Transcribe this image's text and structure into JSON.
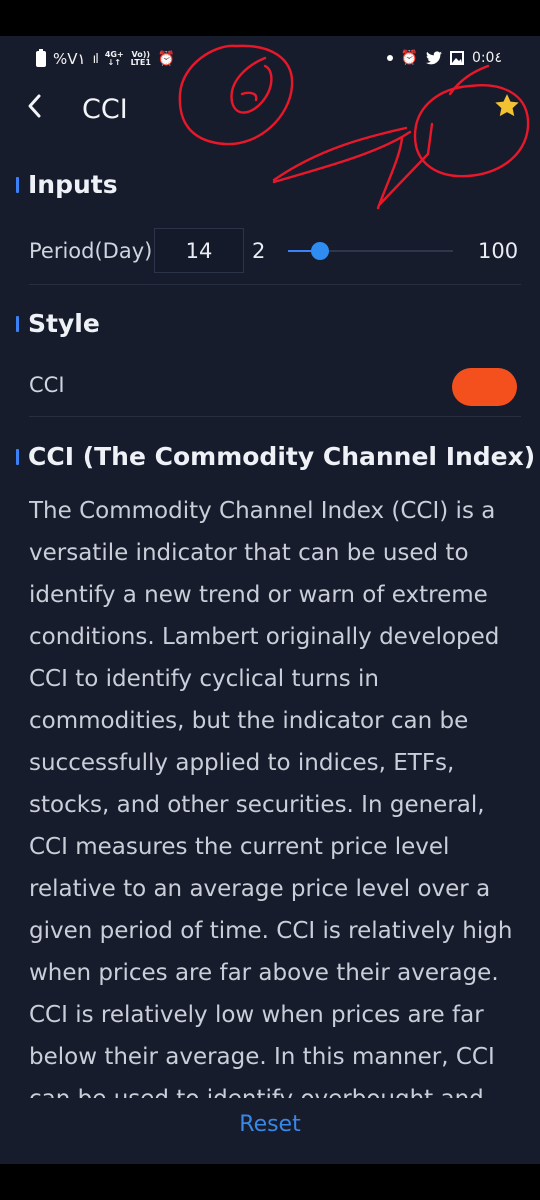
{
  "status_bar": {
    "left_text": "%V١",
    "signal_glyph": "ıl",
    "network_top": "4G+",
    "network_bottom": "LTE1",
    "volte_top": "Vo))",
    "time": "0:0٤",
    "icons": [
      "battery-icon",
      "signal-icon",
      "alarm-icon",
      "dot-icon",
      "alarm-icon",
      "twitter-icon",
      "gallery-icon"
    ]
  },
  "header": {
    "title": "CCI",
    "star_color": "#f2c233"
  },
  "inputs": {
    "heading": "Inputs",
    "period_label": "Period(Day)",
    "period_value": "14",
    "slider_min": "2",
    "slider_max": "100",
    "slider_value": 14
  },
  "style": {
    "heading": "Style",
    "cci_label": "CCI",
    "cci_color": "#f4501e"
  },
  "description": {
    "heading": "CCI (The Commodity Channel Index)",
    "body": "The Commodity Channel Index (CCI) is a versatile indicator that can be used to identify a new trend or warn of extreme conditions. Lambert originally developed CCI to identify cyclical turns in commodities, but the indicator can be successfully applied to indices, ETFs, stocks, and other securities. In general, CCI measures the current price level relative to an average price level over a given period of time. CCI is relatively high when prices are far above their average. CCI is relatively low when prices are far below their average. In this manner, CCI can be used to identify overbought and"
  },
  "footer": {
    "reset_label": "Reset"
  },
  "colors": {
    "background": "#161c2c",
    "accent": "#3b82f6",
    "annotation": "#e8182a"
  }
}
